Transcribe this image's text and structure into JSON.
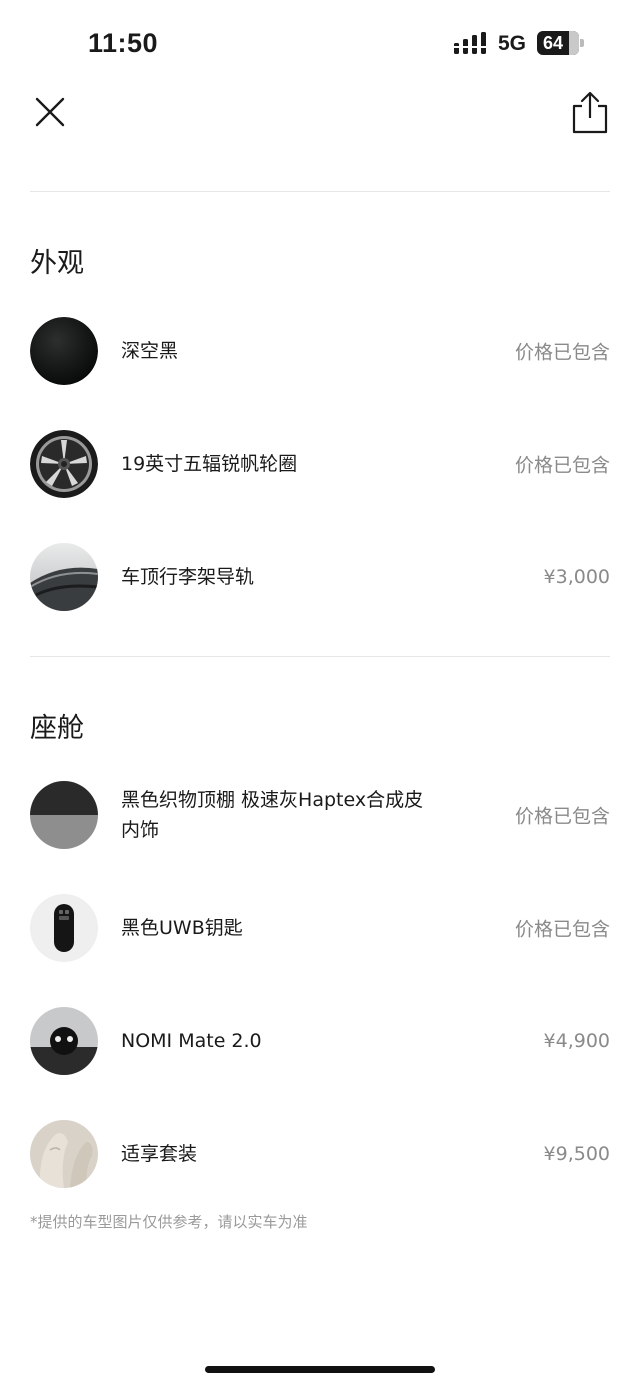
{
  "status_bar": {
    "time": "11:50",
    "network": "5G",
    "battery": "64"
  },
  "header": {
    "close_icon": "close-icon",
    "share_icon": "share-icon"
  },
  "sections": [
    {
      "title": "外观",
      "items": [
        {
          "label": "深空黑",
          "price": "价格已包含",
          "thumb": "paint-swatch"
        },
        {
          "label": "19英寸五辐锐帆轮圈",
          "price": "价格已包含",
          "thumb": "wheel"
        },
        {
          "label": "车顶行李架导轨",
          "price": "¥3,000",
          "thumb": "roof-rail"
        }
      ]
    },
    {
      "title": "座舱",
      "items": [
        {
          "label": "黑色织物顶棚 极速灰Haptex合成皮内饰",
          "price": "价格已包含",
          "thumb": "interior-swatch"
        },
        {
          "label": "黑色UWB钥匙",
          "price": "价格已包含",
          "thumb": "key-fob"
        },
        {
          "label": "NOMI Mate 2.0",
          "price": "¥4,900",
          "thumb": "nomi-robot"
        },
        {
          "label": "适享套装",
          "price": "¥9,500",
          "thumb": "seat"
        }
      ]
    }
  ],
  "footnote": "*提供的车型图片仅供参考，请以实车为准",
  "colors": {
    "text": "#1a1a1a",
    "muted": "#8a8a8a",
    "divider": "#e6e6e6"
  }
}
